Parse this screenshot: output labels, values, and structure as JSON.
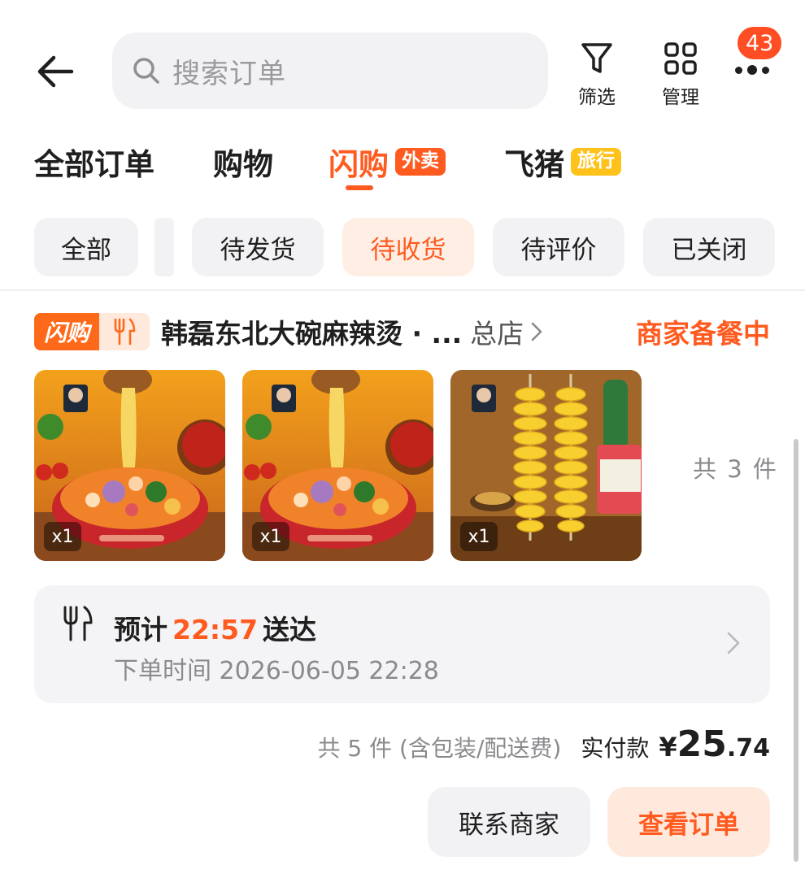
{
  "header": {
    "search_placeholder": "搜索订单",
    "filter_label": "筛选",
    "manage_label": "管理",
    "more_badge": "43"
  },
  "top_tabs": [
    {
      "label": "全部订单",
      "active": false
    },
    {
      "label": "购物",
      "active": false
    },
    {
      "label": "闪购",
      "tag": "外卖",
      "tag_color": "#ff5a1f",
      "active": true
    },
    {
      "label": "飞猪",
      "tag": "旅行",
      "tag_color": "#ffc21a",
      "active": false
    }
  ],
  "status_chips": [
    {
      "label": "全部",
      "active": false
    },
    {
      "label": "待发货",
      "active": false
    },
    {
      "label": "待收货",
      "active": true
    },
    {
      "label": "待评价",
      "active": false
    },
    {
      "label": "已关闭",
      "active": false
    }
  ],
  "order": {
    "platform_tag": "闪购",
    "shop_name": "韩磊东北大碗麻辣烫 · ...",
    "shop_branch": "总店",
    "status": "商家备餐中",
    "items": [
      {
        "kind": "麻辣烫",
        "qty": "x1"
      },
      {
        "kind": "麻辣烫",
        "qty": "x1"
      },
      {
        "kind": "旋风土豆",
        "qty": "x1"
      }
    ],
    "items_count": "共 3 件",
    "eta_prefix": "预计",
    "eta_time": "22:57",
    "eta_suffix": "送达",
    "order_time": "下单时间 2026-06-05 22:28",
    "summary": "共 5 件 (含包装/配送费)",
    "paid_label": "实付款",
    "currency": "¥",
    "amount_int": "25",
    "amount_dec": ".74",
    "contact_button": "联系商家",
    "view_button": "查看订单"
  },
  "colors": {
    "accent": "#ff5a1f",
    "badge": "#ff4d24",
    "chip_bg": "#f2f2f4",
    "active_chip_bg": "#ffeee4"
  }
}
